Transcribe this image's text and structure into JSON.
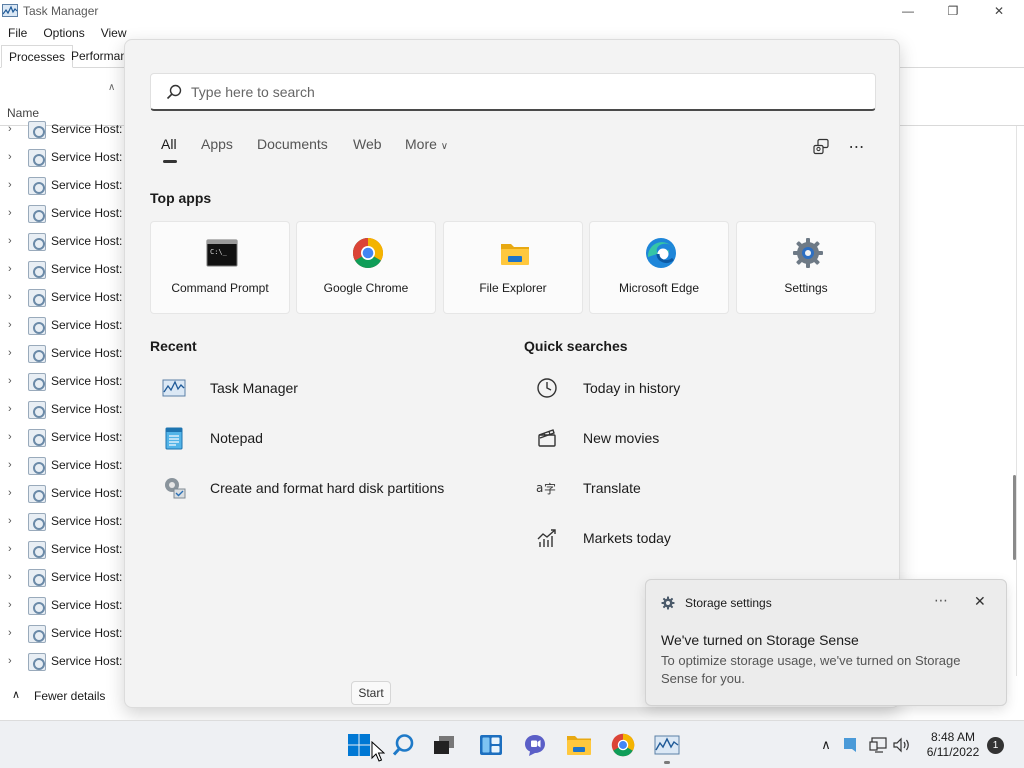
{
  "task_manager": {
    "title": "Task Manager",
    "menu": [
      "File",
      "Options",
      "View"
    ],
    "tabs": [
      "Processes",
      "Performan"
    ],
    "column_name": "Name",
    "rows": [
      "Service Host: U",
      "Service Host: S",
      "Service Host: S",
      "Service Host: S",
      "Service Host: S",
      "Service Host: S",
      "Service Host: S",
      "Service Host: S",
      "Service Host: T",
      "Service Host: T",
      "Service Host: T",
      "Service Host: T",
      "Service Host: T",
      "Service Host: U",
      "Service Host: U",
      "Service Host: U",
      "Service Host: U",
      "Service Host: U",
      "Service Host: U",
      "Service Host: W"
    ],
    "footer": "Fewer details"
  },
  "search": {
    "placeholder": "Type here to search",
    "filters": [
      "All",
      "Apps",
      "Documents",
      "Web",
      "More"
    ],
    "active_filter": "All"
  },
  "top_apps": {
    "title": "Top apps",
    "apps": [
      {
        "label": "Command Prompt",
        "icon": "command-prompt-icon"
      },
      {
        "label": "Google Chrome",
        "icon": "chrome-icon"
      },
      {
        "label": "File Explorer",
        "icon": "folder-icon"
      },
      {
        "label": "Microsoft Edge",
        "icon": "edge-icon"
      },
      {
        "label": "Settings",
        "icon": "settings-gear-icon"
      }
    ]
  },
  "recent": {
    "title": "Recent",
    "items": [
      {
        "label": "Task Manager",
        "icon": "task-manager-icon"
      },
      {
        "label": "Notepad",
        "icon": "notepad-icon"
      },
      {
        "label": "Create and format hard disk partitions",
        "icon": "disk-management-icon"
      }
    ]
  },
  "quick_searches": {
    "title": "Quick searches",
    "items": [
      {
        "label": "Today in history",
        "icon": "clock-icon"
      },
      {
        "label": "New movies",
        "icon": "clapperboard-icon"
      },
      {
        "label": "Translate",
        "icon": "translate-icon"
      },
      {
        "label": "Markets today",
        "icon": "chart-icon"
      }
    ]
  },
  "start_tooltip": "Start",
  "toast": {
    "app": "Storage settings",
    "title": "We've turned on Storage Sense",
    "body": "To optimize storage usage, we've turned on Storage Sense for you."
  },
  "taskbar": {
    "time": "8:48 AM",
    "date": "6/11/2022",
    "notification_count": "1"
  },
  "colors": {
    "accent": "#0067c0",
    "panel_bg": "#f3f3f3",
    "taskbar_bg": "#eef0f3"
  }
}
